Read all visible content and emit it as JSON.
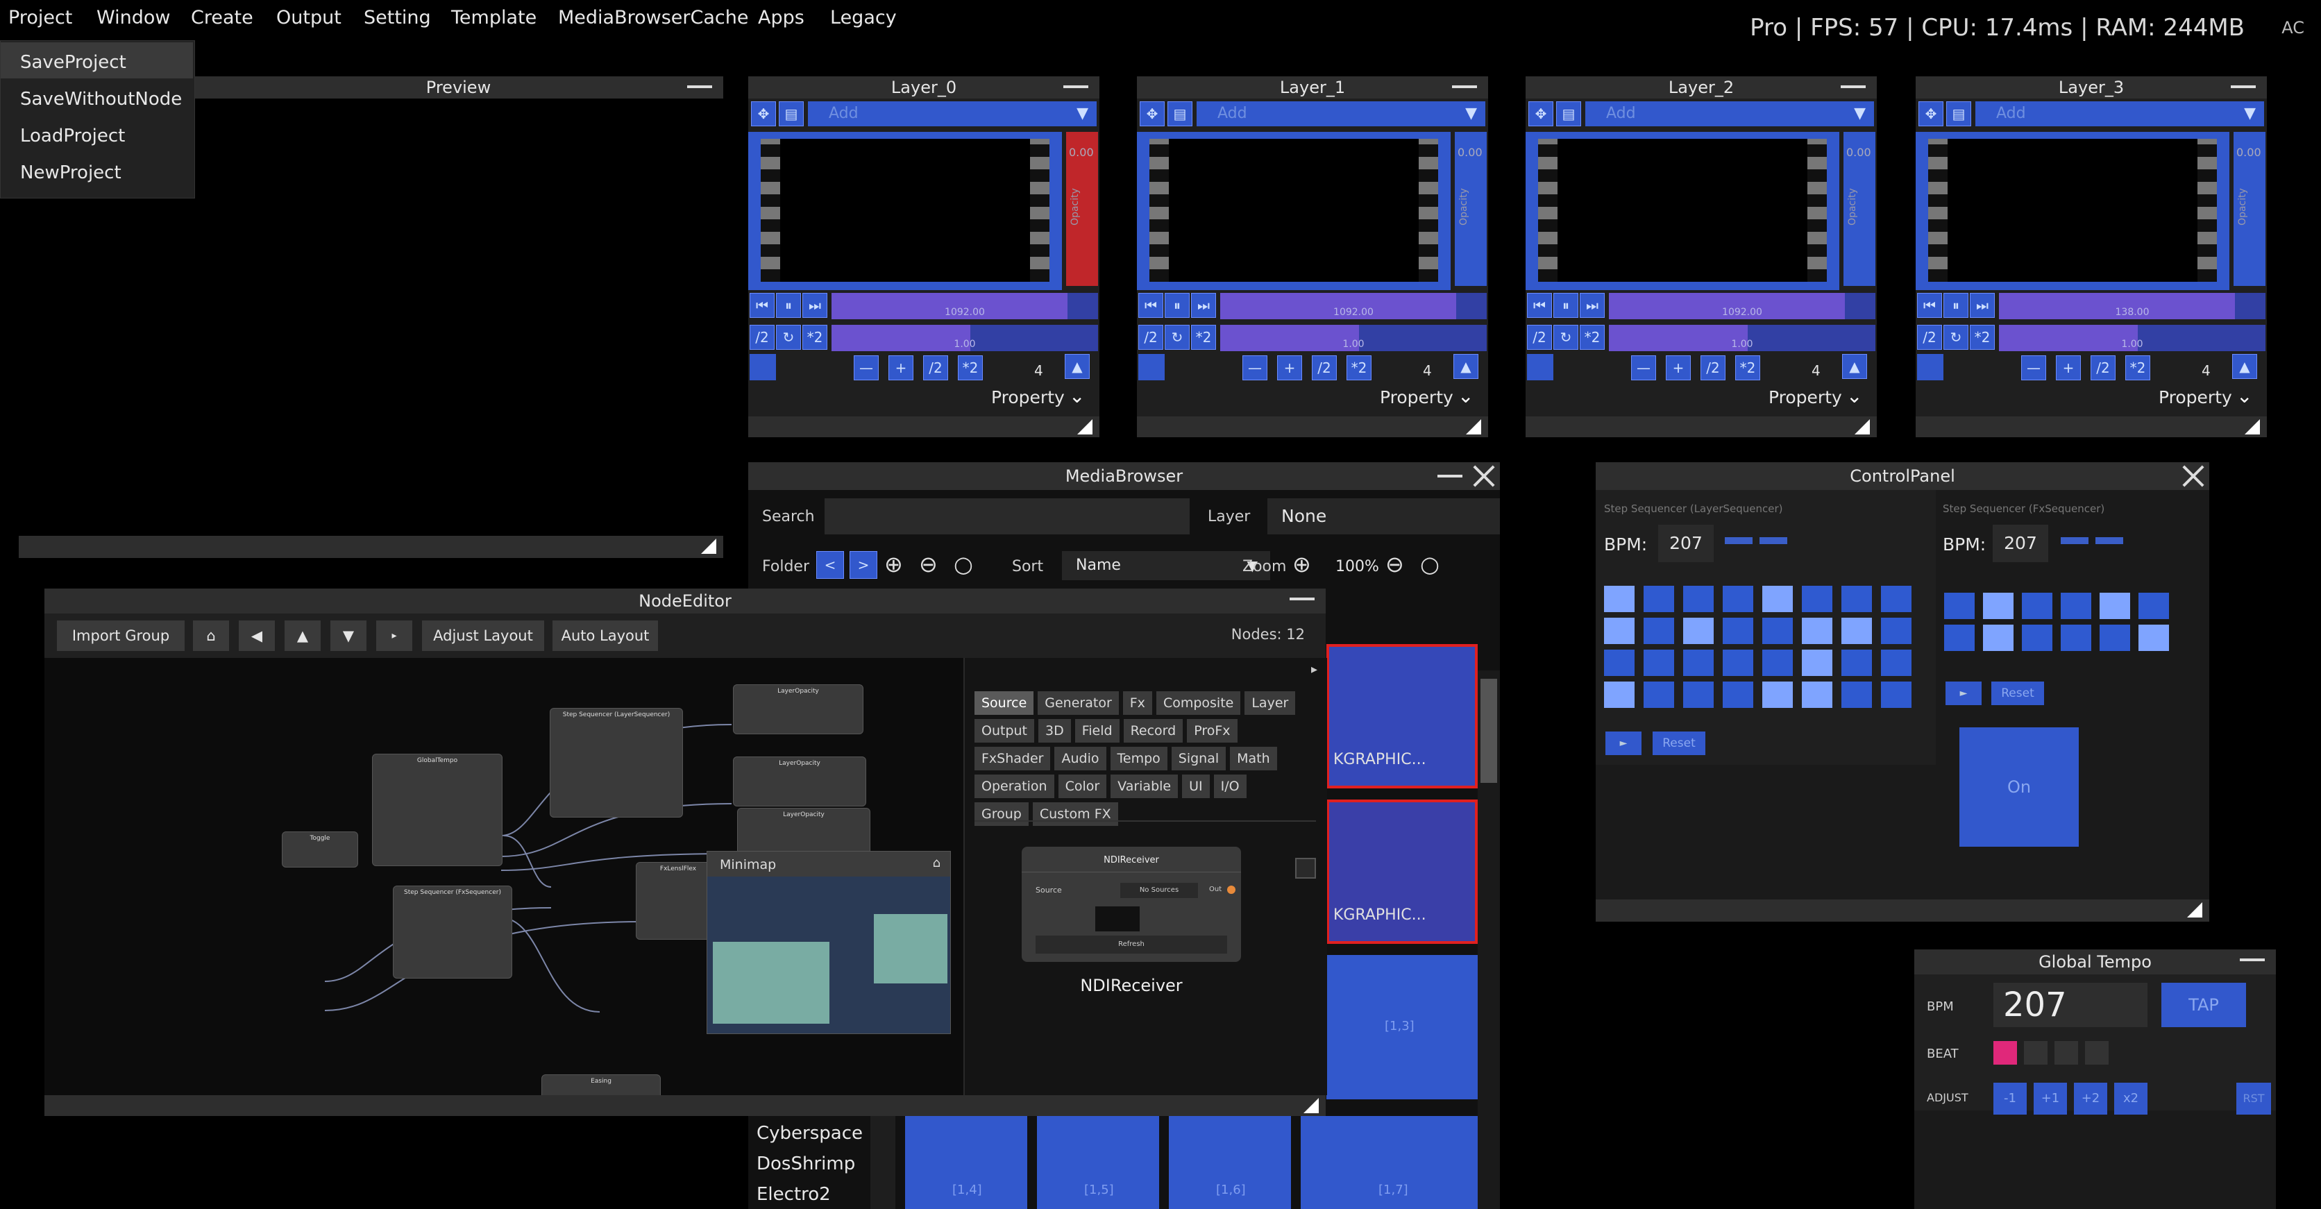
{
  "menubar": {
    "items": [
      "Project",
      "Window",
      "Create",
      "Output",
      "Setting",
      "Template",
      "MediaBrowserCache",
      "Apps",
      "Legacy"
    ],
    "stats": "Pro | FPS: 57 | CPU: 17.4ms | RAM: 244MB",
    "stats_tail": "AC"
  },
  "project_menu": {
    "items": [
      "SaveProject",
      "SaveWithoutNode",
      "LoadProject",
      "NewProject"
    ]
  },
  "preview": {
    "title": "Preview"
  },
  "layers": [
    {
      "title": "Layer_0",
      "add_placeholder": "Add",
      "opacity": "0.00",
      "opacity_label": "Opacity",
      "speed": "1092.00",
      "rate": "1.00",
      "count": "4",
      "property_label": "Property",
      "accent": "#c0262a"
    },
    {
      "title": "Layer_1",
      "add_placeholder": "Add",
      "opacity": "0.00",
      "opacity_label": "Opacity",
      "speed": "1092.00",
      "rate": "1.00",
      "count": "4",
      "property_label": "Property",
      "accent": "#3258cc"
    },
    {
      "title": "Layer_2",
      "add_placeholder": "Add",
      "opacity": "0.00",
      "opacity_label": "Opacity",
      "speed": "1092.00",
      "rate": "1.00",
      "count": "4",
      "property_label": "Property",
      "accent": "#3258cc"
    },
    {
      "title": "Layer_3",
      "add_placeholder": "Add",
      "opacity": "0.00",
      "opacity_label": "Opacity",
      "speed": "138.00",
      "rate": "1.00",
      "count": "4",
      "property_label": "Property",
      "accent": "#3258cc"
    }
  ],
  "layer_buttons": {
    "half": "/2",
    "double": "*2"
  },
  "media_browser": {
    "title": "MediaBrowser",
    "search_label": "Search",
    "layer_label": "Layer",
    "layer_value": "None",
    "folder_label": "Folder",
    "sort_label": "Sort",
    "sort_value": "Name",
    "zoom_label": "Zoom",
    "zoom_value": "100%",
    "thumbs": [
      "KGRAPHIC...",
      "KGRAPHIC...",
      "[1,3]",
      "[1,4]",
      "[1,5]",
      "[1,6]",
      "[1,7]"
    ],
    "folders": [
      "Cyberspace",
      "DosShrimp",
      "Electro2"
    ]
  },
  "control_panel": {
    "title": "ControlPanel",
    "seq1_title": "Step Sequencer (LayerSequencer)",
    "seq2_title": "Step Sequencer (FxSequencer)",
    "bpm_label": "BPM:",
    "bpm1": "207",
    "bpm2": "207",
    "reset_label": "Reset",
    "on_label": "On"
  },
  "global_tempo": {
    "title": "Global Tempo",
    "bpm_label": "BPM",
    "bpm_value": "207",
    "tap_label": "TAP",
    "beat_label": "BEAT",
    "adjust_label": "ADJUST",
    "adjust_buttons": [
      "-1",
      "+1",
      "+2",
      "x2"
    ],
    "rst_label": "RST",
    "beat_color": "#e0287a"
  },
  "node_editor": {
    "title": "NodeEditor",
    "import_group": "Import Group",
    "adjust_layout": "Adjust Layout",
    "auto_layout": "Auto Layout",
    "nodes_count": "Nodes: 12",
    "minimap_label": "Minimap",
    "categories": [
      "Source",
      "Generator",
      "Fx",
      "Composite",
      "Layer",
      "Output",
      "3D",
      "Field",
      "Record",
      "ProFx",
      "FxShader",
      "Audio",
      "Tempo",
      "Signal",
      "Math",
      "Operation",
      "Color",
      "Variable",
      "UI",
      "I/O",
      "Group",
      "Custom FX"
    ],
    "preview_node_title": "NDIReceiver",
    "preview_node_source_label": "Source",
    "preview_node_source_value": "No Sources",
    "preview_node_out": "Out",
    "preview_node_refresh": "Refresh",
    "preview_node_caption": "NDIReceiver",
    "graph_nodes": [
      "GlobalTempo",
      "Toggle",
      "Step Sequencer (LayerSequencer)",
      "Step Sequencer (FxSequencer)",
      "LayerOpacity",
      "LayerOpacity",
      "LayerOpacity",
      "Easing",
      "FxLenslFlex"
    ]
  }
}
